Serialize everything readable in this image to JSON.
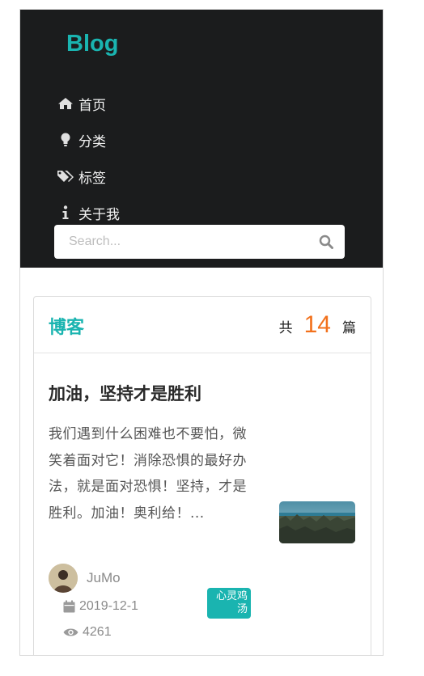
{
  "header": {
    "brand": "Blog",
    "nav": [
      {
        "label": "首页",
        "icon": "home-icon"
      },
      {
        "label": "分类",
        "icon": "lightbulb-icon"
      },
      {
        "label": "标签",
        "icon": "tags-icon"
      },
      {
        "label": "关于我",
        "icon": "info-icon"
      }
    ],
    "search": {
      "placeholder": "Search...",
      "value": ""
    }
  },
  "blog_card": {
    "title": "博客",
    "count_prefix": "共",
    "count": "14",
    "count_suffix": "篇",
    "post": {
      "title": "加油，坚持才是胜利",
      "excerpt": "我们遇到什么困难也不要怕，微笑着面对它！消除恐惧的最好办法，就是面对恐惧！坚持，才是胜利。加油！奥利给！...",
      "author": "JuMo",
      "date": "2019-12-1",
      "views": "4261",
      "category": "心灵鸡汤"
    }
  },
  "colors": {
    "accent": "#1ab4b0",
    "count": "#f2711c",
    "header_bg": "#1b1c1d"
  }
}
